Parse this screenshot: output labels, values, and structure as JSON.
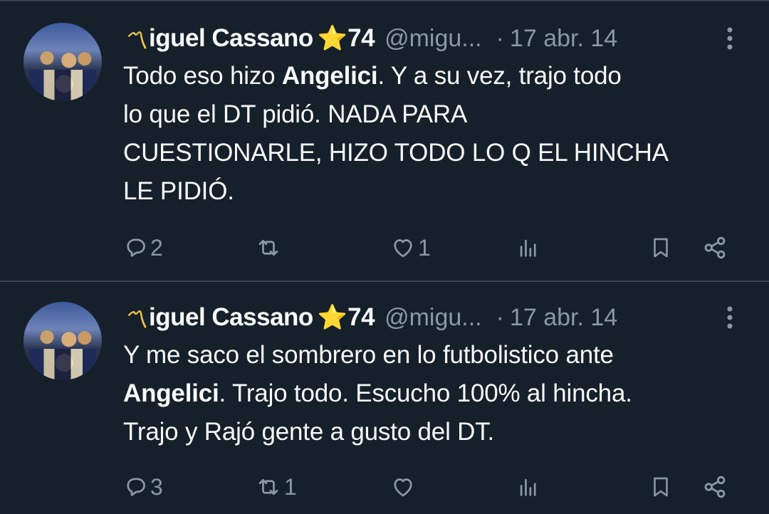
{
  "tweets": [
    {
      "author": {
        "name_prefix": "〽",
        "name": "iguel Cassano",
        "emoji": "⭐",
        "name_suffix": "74",
        "handle": "@migu...",
        "avatar_icon": "user-avatar"
      },
      "separator": "·",
      "date": "17 abr. 14",
      "text_parts": [
        "Todo eso hizo ",
        "Angelici",
        ". Y a su vez, trajo todo\nlo que el DT pidió. NADA PARA\nCUESTIONARLE, HIZO TODO LO Q EL HINCHA\nLE PIDIÓ."
      ],
      "actions": {
        "replies": "2",
        "retweets": "",
        "likes": "1",
        "views": ""
      }
    },
    {
      "author": {
        "name_prefix": "〽",
        "name": "iguel Cassano",
        "emoji": "⭐",
        "name_suffix": "74",
        "handle": "@migu...",
        "avatar_icon": "user-avatar"
      },
      "separator": "·",
      "date": "17 abr. 14",
      "text_parts": [
        "Y me saco el sombrero en lo futbolistico ante\n",
        "Angelici",
        ". Trajo todo. Escucho 100% al hincha.\nTrajo y Rajó gente a gusto del DT."
      ],
      "actions": {
        "replies": "3",
        "retweets": "1",
        "likes": "",
        "views": ""
      }
    }
  ],
  "colors": {
    "background": "#15202b",
    "text": "#f7f9f9",
    "secondary": "#8b98a5",
    "divider": "#38444d"
  }
}
